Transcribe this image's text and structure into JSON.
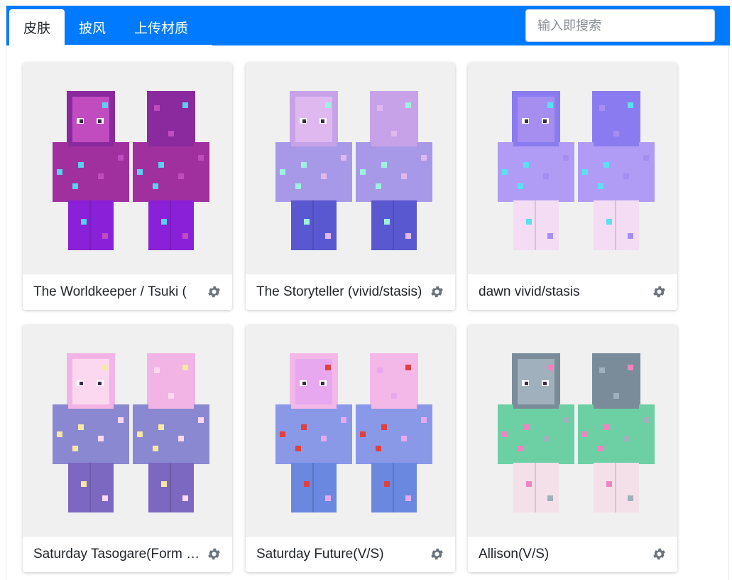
{
  "tabs": [
    {
      "label": "皮肤",
      "active": true
    },
    {
      "label": "披风",
      "active": false
    },
    {
      "label": "上传材质",
      "active": false
    }
  ],
  "search": {
    "placeholder": "输入即搜索",
    "value": ""
  },
  "cards": [
    {
      "name": "The Worldkeeper / Tsuki (",
      "palette": {
        "hair": "#8a2a9e",
        "body": "#a0309e",
        "accent": "#c04cc0",
        "legs": "#8a20d8",
        "detail": "#5ad0f0"
      }
    },
    {
      "name": "The Storyteller (vivid/stasis)",
      "palette": {
        "hair": "#c7a2e8",
        "body": "#a898e8",
        "accent": "#e0b8f0",
        "legs": "#5a58d0",
        "detail": "#9ef0e0"
      }
    },
    {
      "name": "dawn vivid/stasis",
      "palette": {
        "hair": "#8a7cf0",
        "body": "#b09cf4",
        "accent": "#a58ef0",
        "legs": "#f4dcf4",
        "detail": "#5ae0f0"
      }
    },
    {
      "name": "Saturday Tasogare(Form change)",
      "palette": {
        "hair": "#f2b4e4",
        "body": "#8a88d0",
        "accent": "#fcd8f0",
        "legs": "#7c68c0",
        "detail": "#f6e8a0"
      }
    },
    {
      "name": "Saturday Future(V/S)",
      "palette": {
        "hair": "#f4b8e8",
        "body": "#8a98e8",
        "accent": "#e8a8f0",
        "legs": "#6a88e0",
        "detail": "#e04040"
      }
    },
    {
      "name": "Allison(V/S)",
      "palette": {
        "hair": "#7a8c9a",
        "body": "#6cd0a4",
        "accent": "#a0b0bc",
        "legs": "#f4e0e8",
        "detail": "#f084c0"
      }
    }
  ]
}
